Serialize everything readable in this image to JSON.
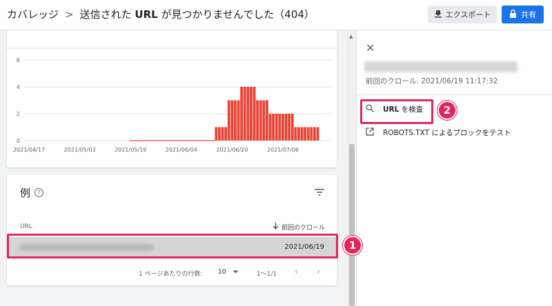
{
  "header": {
    "breadcrumb_root": "カバレッジ",
    "breadcrumb_sep": ">",
    "title_before": "送信された",
    "title_url": "URL",
    "title_after": "が見つかりませんでした（404）",
    "export_label": "エクスポート",
    "share_label": "共有",
    "accent_color": "#1a73e8"
  },
  "chart_data": {
    "type": "bar",
    "x_ticks": [
      "2021/04/17",
      "2021/05/03",
      "2021/05/19",
      "2021/06/04",
      "2021/06/20",
      "2021/07/06"
    ],
    "y_ticks": [
      "0",
      "2",
      "4",
      "6"
    ],
    "ylim": [
      0,
      6
    ],
    "color": "#ea4335",
    "start_date": "2021/04/17",
    "days": [
      "2021/06/15",
      "2021/06/16",
      "2021/06/17",
      "2021/06/18",
      "2021/06/19",
      "2021/06/20",
      "2021/06/21",
      "2021/06/22",
      "2021/06/23",
      "2021/06/24",
      "2021/06/25",
      "2021/06/26",
      "2021/06/27",
      "2021/06/28",
      "2021/06/29",
      "2021/06/30",
      "2021/07/01",
      "2021/07/02",
      "2021/07/03",
      "2021/07/04",
      "2021/07/05",
      "2021/07/06",
      "2021/07/07",
      "2021/07/08",
      "2021/07/09",
      "2021/07/10",
      "2021/07/11",
      "2021/07/12",
      "2021/07/13",
      "2021/07/14",
      "2021/07/15",
      "2021/07/16",
      "2021/07/17"
    ],
    "values": [
      1,
      1,
      1,
      1,
      3,
      3,
      3,
      3,
      4,
      4,
      4,
      4,
      4,
      3,
      3,
      3,
      3,
      2,
      2,
      2,
      2,
      2,
      2,
      2,
      2,
      1,
      1,
      1,
      1,
      1,
      1,
      1,
      1
    ],
    "grid": true
  },
  "examples": {
    "title": "例",
    "col_url": "URL",
    "col_crawl": "前回のクロール",
    "rows": [
      {
        "date": "2021/06/19"
      }
    ],
    "rows_per_page_label": "1 ページあたりの行数:",
    "rows_per_page": "10",
    "range": "1〜1/1"
  },
  "panel": {
    "last_crawl": "前回のクロール: 2021/06/19 11:17:32",
    "inspect_url": "URL",
    "inspect_suffix": "を検査",
    "robots_label": "ROBOTS.TXT",
    "robots_suffix": "によるブロックをテスト"
  },
  "annotations": {
    "badge1": "1",
    "badge2": "2",
    "color": "#e6245c"
  }
}
